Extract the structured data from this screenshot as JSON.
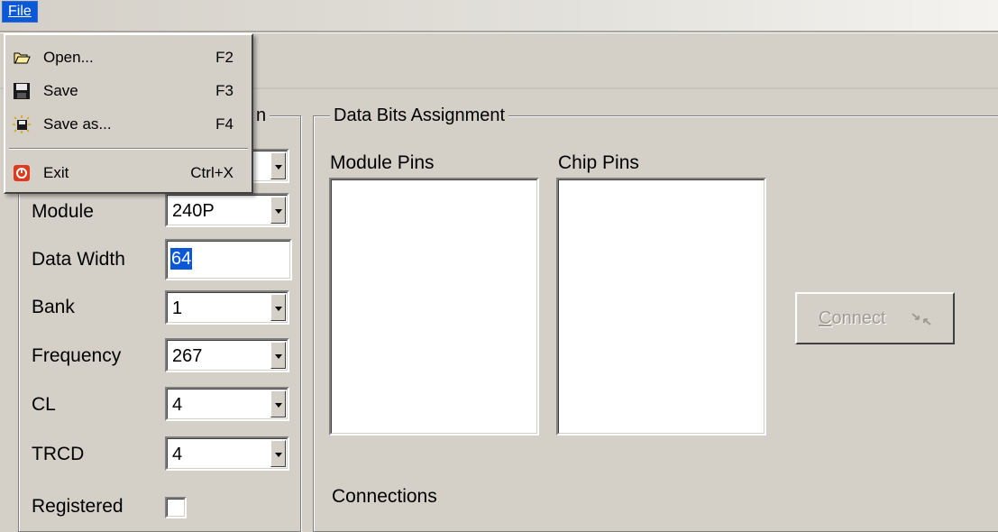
{
  "menubar": {
    "file_label": "File"
  },
  "file_menu": {
    "items": [
      {
        "label": "Open...",
        "shortcut": "F2",
        "icon": "open-folder-icon"
      },
      {
        "label": "Save",
        "shortcut": "F3",
        "icon": "floppy-disk-icon"
      },
      {
        "label": "Save as...",
        "shortcut": "F4",
        "icon": "save-as-icon"
      },
      {
        "label": "Exit",
        "shortcut": "Ctrl+X",
        "icon": "exit-icon"
      }
    ]
  },
  "left_group": {
    "title_visible_fragment": "n",
    "fields": [
      {
        "label": "Module",
        "value": "240P",
        "type": "combo"
      },
      {
        "label": "Data Width",
        "value": "64",
        "type": "text",
        "selected": true
      },
      {
        "label": "Bank",
        "value": "1",
        "type": "combo"
      },
      {
        "label": "Frequency",
        "value": "267",
        "type": "combo"
      },
      {
        "label": "CL",
        "value": "4",
        "type": "combo"
      },
      {
        "label": "TRCD",
        "value": "4",
        "type": "combo"
      }
    ],
    "registered_label": "Registered",
    "registered_checked": false
  },
  "data_bits": {
    "title": "Data Bits Assignment",
    "module_pins_label": "Module Pins",
    "chip_pins_label": "Chip Pins",
    "connections_label": "Connections",
    "connect_button": {
      "label_first": "C",
      "label_rest": "onnect",
      "enabled": false,
      "icon": "connect-arrows-icon"
    }
  },
  "colors": {
    "window_bg": "#d4d0c8",
    "menu_highlight": "#0a58d8",
    "selection": "#0a58d8",
    "disabled_text": "#a09c94"
  }
}
